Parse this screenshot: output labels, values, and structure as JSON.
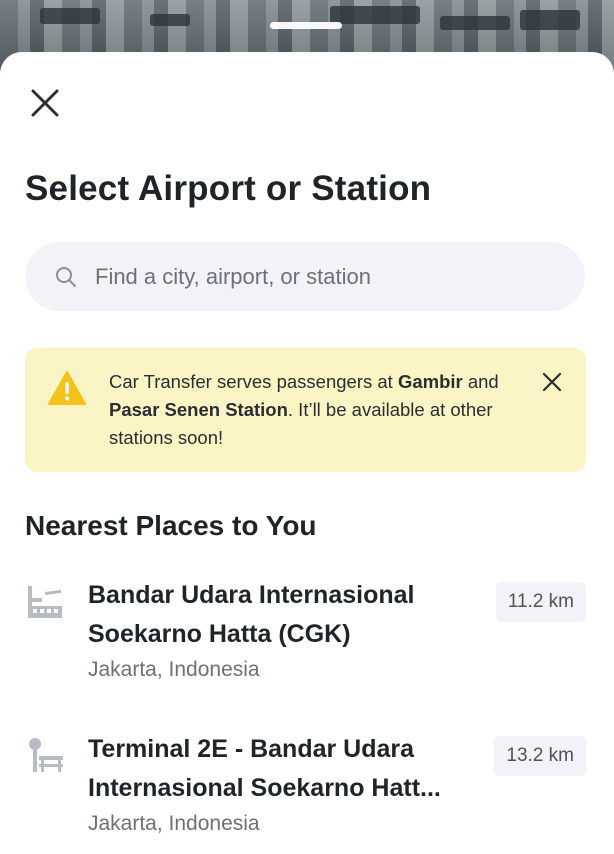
{
  "header": {
    "title": "Select Airport or Station"
  },
  "search": {
    "placeholder": "Find a city, airport, or station",
    "value": ""
  },
  "notice": {
    "text_1": "Car Transfer serves passengers at ",
    "bold_1": "Gambir",
    "text_2": " and ",
    "bold_2": "Pasar Senen Station",
    "text_3": ". It’ll be available at other stations soon!"
  },
  "nearest": {
    "title": "Nearest Places to You",
    "items": [
      {
        "icon": "airport-icon",
        "name": "Bandar Udara Internasional Soekarno Hatta (CGK)",
        "location": "Jakarta, Indonesia",
        "distance": "11.2 km"
      },
      {
        "icon": "terminal-icon",
        "name": "Terminal 2E - Bandar Udara Internasional Soekarno Hatt...",
        "location": "Jakarta, Indonesia",
        "distance": "13.2 km"
      }
    ]
  },
  "colors": {
    "notice_bg": "#fbf4c4",
    "warning": "#f4c21a",
    "search_bg": "#f2f3f8",
    "text_primary": "#1f2428",
    "text_secondary": "#6c7178"
  }
}
